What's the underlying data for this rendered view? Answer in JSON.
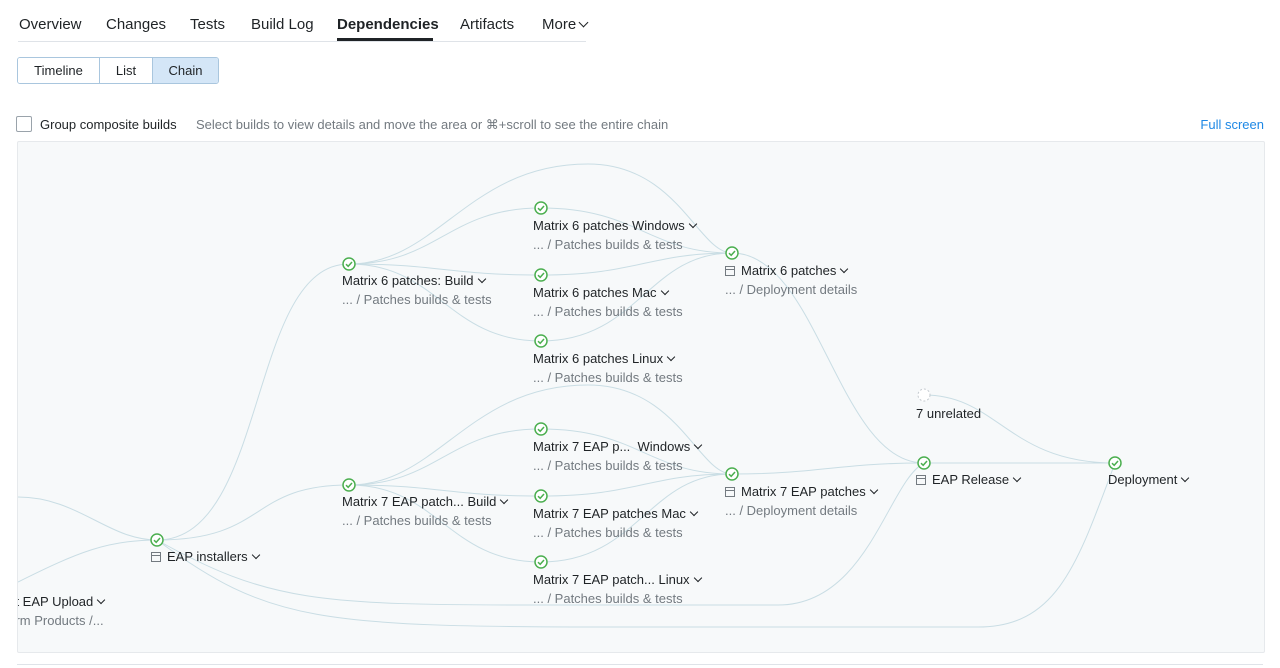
{
  "tabs": {
    "overview": "Overview",
    "changes": "Changes",
    "tests": "Tests",
    "build_log": "Build Log",
    "dependencies": "Dependencies",
    "artifacts": "Artifacts",
    "more": "More"
  },
  "view_toggle": {
    "timeline": "Timeline",
    "list": "List",
    "chain": "Chain",
    "selected": "Chain"
  },
  "options": {
    "group_composite_label": "Group composite builds",
    "group_composite_checked": false,
    "hint": "Select builds to view details and move the area or ⌘+scroll to see the entire chain",
    "full_screen": "Full screen"
  },
  "colors": {
    "success": "#4caf50",
    "accent": "#1e88e5",
    "edge": "#c9dde4"
  },
  "chain": {
    "nodes": {
      "upload": {
        "title": "ent EAP Upload",
        "sub": "tform Products /..."
      },
      "eap_installers": {
        "title": "EAP installers",
        "status": "success",
        "composite": true
      },
      "m6_build": {
        "title": "Matrix 6 patches: Build",
        "sub": "... / Patches builds & tests",
        "status": "success"
      },
      "m6_windows": {
        "title": "Matrix 6 patches Windows",
        "sub": "... / Patches builds & tests",
        "status": "success"
      },
      "m6_mac": {
        "title": "Matrix 6 patches Mac",
        "sub": "... / Patches builds & tests",
        "status": "success"
      },
      "m6_linux": {
        "title": "Matrix 6 patches Linux",
        "sub": "... / Patches builds & tests",
        "status": "success"
      },
      "m6_patches": {
        "title": "Matrix 6 patches",
        "sub": "... / Deployment details",
        "status": "success",
        "composite": true
      },
      "m7_build": {
        "title": "Matrix 7 EAP patch... Build",
        "sub": "... / Patches builds & tests",
        "status": "success"
      },
      "m7_windows": {
        "title": "Matrix 7 EAP p...  Windows",
        "sub": "... / Patches builds & tests",
        "status": "success"
      },
      "m7_mac": {
        "title": "Matrix 7 EAP patches Mac",
        "sub": "... / Patches builds & tests",
        "status": "success"
      },
      "m7_linux": {
        "title": "Matrix 7 EAP patch... Linux",
        "sub": "... / Patches builds & tests",
        "status": "success"
      },
      "m7_patches": {
        "title": "Matrix 7 EAP patches",
        "sub": "... / Deployment details",
        "status": "success",
        "composite": true
      },
      "unrelated": {
        "title": "7 unrelated",
        "status": "pending"
      },
      "eap_release": {
        "title": "EAP Release",
        "status": "success",
        "composite": true
      },
      "deployment": {
        "title": "Deployment",
        "status": "success"
      }
    }
  }
}
